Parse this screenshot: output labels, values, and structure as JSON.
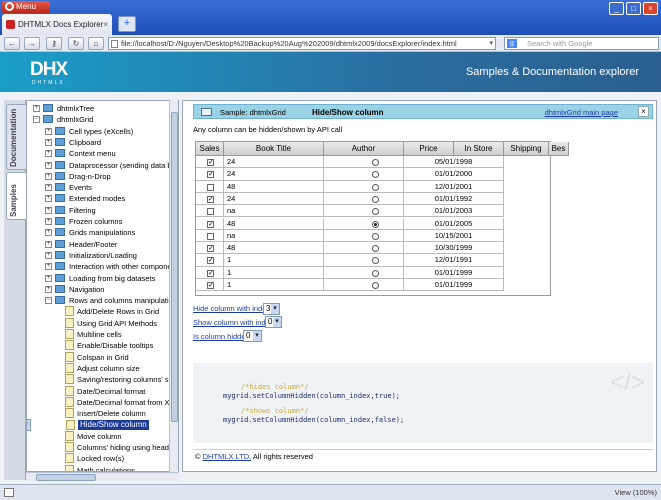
{
  "browser": {
    "menu_label": "Menu",
    "tab_title": "DHTMLX Docs Explorer",
    "tab_close": "×",
    "new_tab": "+",
    "url": "file://localhost/D:/Nguyen/Desktop%20Backup%20Aug%202009/dhtmlx2009/docsExplorer/index.html",
    "search_placeholder": "Search with Google",
    "zoom": "View (100%)",
    "nav": {
      "back": "←",
      "forward": "→",
      "key": "⚷",
      "reload": "↻",
      "home": "⌂"
    }
  },
  "banner": {
    "logo": "DHX",
    "logo_sub": "DHTMLX",
    "title": "Samples & Documentation explorer"
  },
  "side_tabs": {
    "documentation": "Documentation",
    "samples": "Samples"
  },
  "tree": [
    {
      "label": "dhtmlxTree",
      "type": "root",
      "toggle": "+"
    },
    {
      "label": "dhtmlxGrid",
      "type": "root",
      "toggle": "−"
    },
    {
      "label": "Cell types (eXcells)",
      "type": "folder",
      "toggle": "+"
    },
    {
      "label": "Clipboard",
      "type": "folder",
      "toggle": "+"
    },
    {
      "label": "Context menu",
      "type": "folder",
      "toggle": "+"
    },
    {
      "label": "Dataprocessor (sending data back",
      "type": "folder",
      "toggle": "+"
    },
    {
      "label": "Drag-n-Drop",
      "type": "folder",
      "toggle": "+"
    },
    {
      "label": "Events",
      "type": "folder",
      "toggle": "+"
    },
    {
      "label": "Extended modes",
      "type": "folder",
      "toggle": "+"
    },
    {
      "label": "Filtering",
      "type": "folder",
      "toggle": "+"
    },
    {
      "label": "Frozen columns",
      "type": "folder",
      "toggle": "+"
    },
    {
      "label": "Grids manipulations",
      "type": "folder",
      "toggle": "+"
    },
    {
      "label": "Header/Footer",
      "type": "folder",
      "toggle": "+"
    },
    {
      "label": "Initialization/Loading",
      "type": "folder",
      "toggle": "+"
    },
    {
      "label": "Interaction with other component",
      "type": "folder",
      "toggle": "+"
    },
    {
      "label": "Loading from big datasets",
      "type": "folder",
      "toggle": "+"
    },
    {
      "label": "Navigation",
      "type": "folder",
      "toggle": "+"
    },
    {
      "label": "Rows and columns manipulations",
      "type": "folder",
      "toggle": "−"
    },
    {
      "label": "Add/Delete Rows in Grid",
      "type": "doc"
    },
    {
      "label": "Using Grid API Methods",
      "type": "doc"
    },
    {
      "label": "Multiline cells",
      "type": "doc"
    },
    {
      "label": "Enable/Disable tooltips",
      "type": "doc"
    },
    {
      "label": "Colspan in Grid",
      "type": "doc"
    },
    {
      "label": "Adjust column size",
      "type": "doc"
    },
    {
      "label": "Saving/restoring columns' stat",
      "type": "doc"
    },
    {
      "label": "Date/Decimal format",
      "type": "doc"
    },
    {
      "label": "Date/Decimal format from XML",
      "type": "doc"
    },
    {
      "label": "Insert/Delete column",
      "type": "doc"
    },
    {
      "label": "Hide/Show column",
      "type": "doc",
      "selected": true
    },
    {
      "label": "Move column",
      "type": "doc"
    },
    {
      "label": "Columns' hiding using header n",
      "type": "doc"
    },
    {
      "label": "Locked row(s)",
      "type": "doc"
    },
    {
      "label": "Math calculations",
      "type": "doc"
    }
  ],
  "sample": {
    "prefix": "Sample: dhtmlxGrid",
    "title": "Hide/Show column",
    "main_link": "dhtmlxGrid main page",
    "close": "×",
    "description": "Any column can be hidden/shown by API call"
  },
  "grid": {
    "columns": [
      "Sales",
      "Book Title",
      "Author",
      "Price",
      "In Store",
      "Shipping",
      "Bes"
    ],
    "rows": [
      {
        "checked": true,
        "title": "24",
        "author_on": false,
        "date": "05/01/1998"
      },
      {
        "checked": true,
        "title": "24",
        "author_on": false,
        "date": "01/01/2000"
      },
      {
        "checked": false,
        "title": "48",
        "author_on": false,
        "date": "12/01/2001"
      },
      {
        "checked": true,
        "title": "24",
        "author_on": false,
        "date": "01/01/1992"
      },
      {
        "checked": false,
        "title": "na",
        "author_on": false,
        "date": "01/01/2003"
      },
      {
        "checked": true,
        "title": "48",
        "author_on": true,
        "date": "01/01/2005"
      },
      {
        "checked": false,
        "title": "na",
        "author_on": false,
        "date": "10/15/2001"
      },
      {
        "checked": true,
        "title": "48",
        "author_on": false,
        "date": "10/30/1999"
      },
      {
        "checked": true,
        "title": "1",
        "author_on": false,
        "date": "12/01/1991"
      },
      {
        "checked": true,
        "title": "1",
        "author_on": false,
        "date": "01/01/1999"
      },
      {
        "checked": true,
        "title": "1",
        "author_on": false,
        "date": "01/01/1999"
      }
    ]
  },
  "controls": [
    {
      "label": "Hide column with index",
      "value": "3"
    },
    {
      "label": "Show column with index",
      "value": "0"
    },
    {
      "label": "Is column hidden",
      "value": "0"
    }
  ],
  "code": {
    "c1": "/*hides column*/",
    "l1": "mygrid.setColumnHidden(column_index,true);",
    "c2": "/*shows column*/",
    "l2": "mygrid.setColumnHidden(column_index,false);",
    "tag": "</>"
  },
  "footer": {
    "copy": "©",
    "link": "DHTMLX LTD.",
    "rest": "All rights reserved"
  }
}
